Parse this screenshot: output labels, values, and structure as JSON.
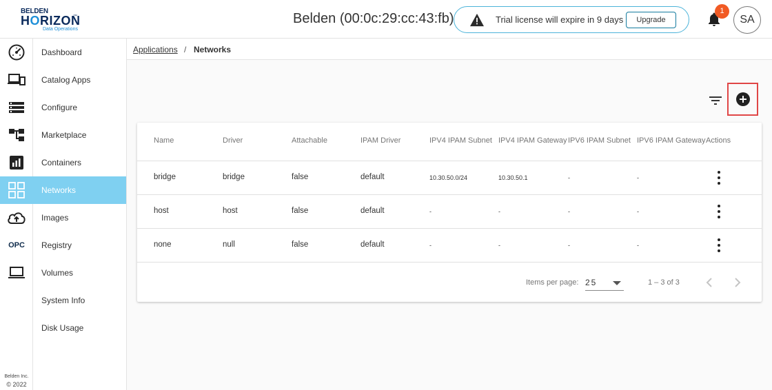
{
  "logo": {
    "line1": "BELDEN",
    "line2a": "H",
    "line2b": "O",
    "line2c": "RIZON",
    "tm": "™",
    "line3": "Data Operations"
  },
  "header": {
    "device_title": "Belden (00:0c:29:cc:43:fb)",
    "license_message": "Trial license will expire in 9 days",
    "upgrade_label": "Upgrade",
    "notification_count": "1",
    "avatar_initials": "SA"
  },
  "nav": {
    "items": [
      {
        "label": "Dashboard",
        "icon": "speedometer-icon"
      },
      {
        "label": "Catalog Apps",
        "icon": "devices-icon"
      },
      {
        "label": "Configure",
        "icon": "list-icon"
      },
      {
        "label": "Marketplace",
        "icon": "hierarchy-icon"
      },
      {
        "label": "Containers",
        "icon": "chart-box-icon"
      },
      {
        "label": "Networks",
        "icon": "grid-icon",
        "active": true
      },
      {
        "label": "Images",
        "icon": "cloud-upload-icon"
      },
      {
        "label": "Registry",
        "icon": "opc-icon",
        "icon_text": "OPC"
      },
      {
        "label": "Volumes",
        "icon": "laptop-icon"
      },
      {
        "label": "System Info"
      },
      {
        "label": "Disk Usage"
      }
    ],
    "copyright_line1": "Belden Inc.",
    "copyright_line2": "© 2022"
  },
  "breadcrumb": {
    "parent": "Applications",
    "separator": "/",
    "current": "Networks"
  },
  "table": {
    "columns": [
      "Name",
      "Driver",
      "Attachable",
      "IPAM Driver",
      "IPV4 IPAM Subnet",
      "IPV4 IPAM Gateway",
      "IPV6 IPAM Subnet",
      "IPV6 IPAM Gateway",
      "Actions"
    ],
    "rows": [
      {
        "name": "bridge",
        "driver": "bridge",
        "attachable": "false",
        "ipam_driver": "default",
        "ipv4_subnet": "10.30.50.0/24",
        "ipv4_gateway": "10.30.50.1",
        "ipv6_subnet": "-",
        "ipv6_gateway": "-"
      },
      {
        "name": "host",
        "driver": "host",
        "attachable": "false",
        "ipam_driver": "default",
        "ipv4_subnet": "-",
        "ipv4_gateway": "-",
        "ipv6_subnet": "-",
        "ipv6_gateway": "-"
      },
      {
        "name": "none",
        "driver": "null",
        "attachable": "false",
        "ipam_driver": "default",
        "ipv4_subnet": "-",
        "ipv4_gateway": "-",
        "ipv6_subnet": "-",
        "ipv6_gateway": "-"
      }
    ]
  },
  "paginator": {
    "items_per_page_label": "Items per page:",
    "page_size": "25",
    "range_label": "1 – 3 of 3"
  },
  "colors": {
    "accent": "#7fd0f1",
    "brand_navy": "#0a2a5c",
    "brand_blue": "#1e8fd8",
    "badge": "#f15a24",
    "highlight_box": "#e04646"
  }
}
